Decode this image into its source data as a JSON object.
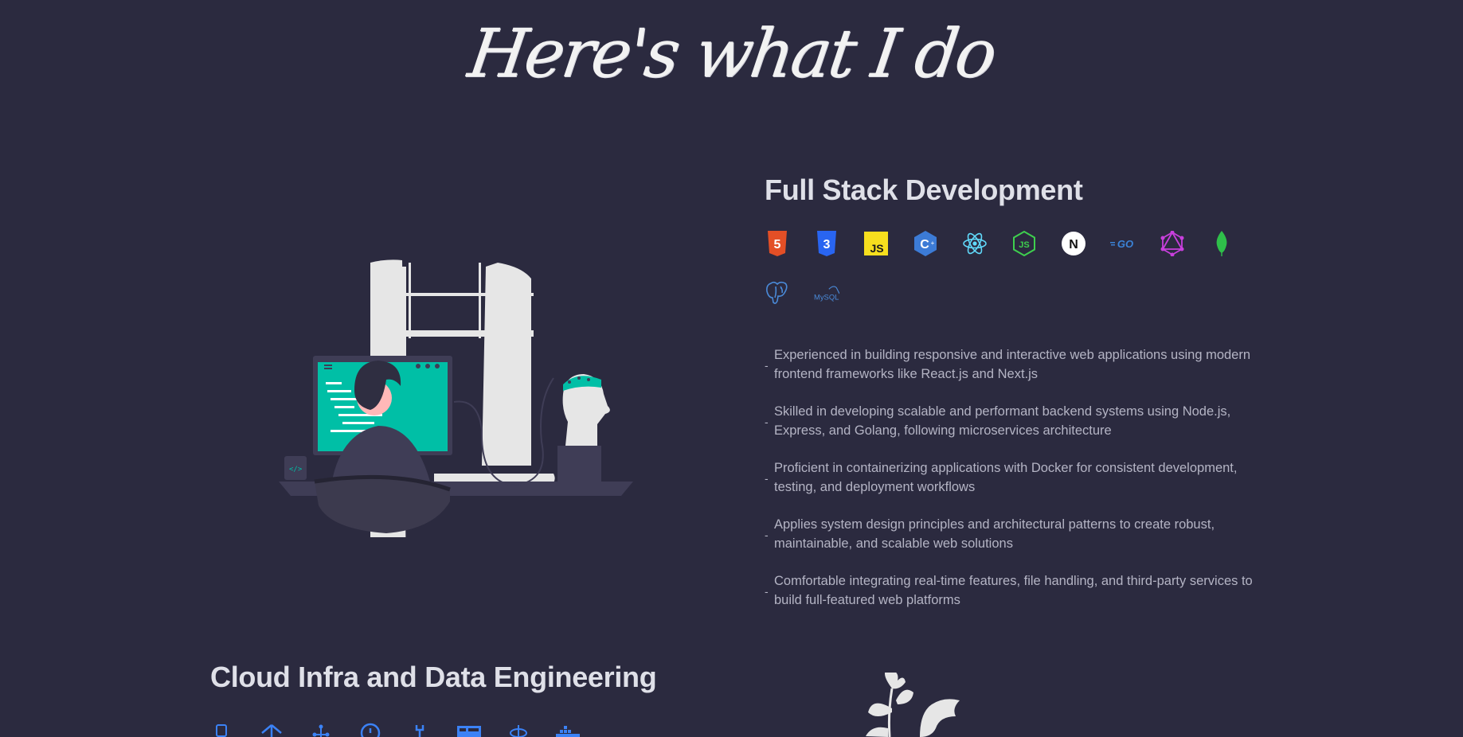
{
  "heading": "Here's what I do",
  "full_stack": {
    "title": "Full Stack Development",
    "icons": [
      {
        "name": "html5-icon",
        "color": "#e34f26",
        "glyph": "5"
      },
      {
        "name": "css3-icon",
        "color": "#2965f1",
        "glyph": "3"
      },
      {
        "name": "javascript-icon",
        "color": "#f7df1e",
        "glyph": "JS"
      },
      {
        "name": "cplusplus-icon",
        "color": "#3c7bd6",
        "glyph": "C"
      },
      {
        "name": "react-icon",
        "color": "#61dafb",
        "glyph": "⚛"
      },
      {
        "name": "nodejs-icon",
        "color": "#3ecf4e",
        "glyph": "JS"
      },
      {
        "name": "nextjs-icon",
        "color": "#ffffff",
        "glyph": "N"
      },
      {
        "name": "golang-icon",
        "color": "#3b82d6",
        "glyph": "GO"
      },
      {
        "name": "graphql-icon",
        "color": "#c83fdc",
        "glyph": "◈"
      },
      {
        "name": "mongodb-icon",
        "color": "#2fbf4a",
        "glyph": "❦"
      },
      {
        "name": "postgresql-icon",
        "color": "#4a8ad8",
        "glyph": "🐘"
      },
      {
        "name": "mysql-icon",
        "color": "#4a8ad8",
        "glyph": "MySQL"
      }
    ],
    "bullets": [
      "Experienced in building responsive and interactive web applications using modern frontend frameworks like React.js and Next.js",
      "Skilled in developing scalable and performant backend systems using Node.js, Express, and Golang, following microservices architecture",
      "Proficient in containerizing applications with Docker for consistent development, testing, and deployment workflows",
      "Applies system design principles and architectural patterns to create robust, maintainable, and scalable web solutions",
      "Comfortable integrating real-time features, file handling, and third-party services to build full-featured web platforms"
    ]
  },
  "cloud": {
    "title": "Cloud Infra and Data Engineering",
    "icons": [
      {
        "name": "server-icon",
        "color": "#3b82f6"
      },
      {
        "name": "network-icon",
        "color": "#3b82f6"
      },
      {
        "name": "hierarchy-icon",
        "color": "#3b82f6"
      },
      {
        "name": "clock-icon",
        "color": "#3b82f6"
      },
      {
        "name": "wrench-icon",
        "color": "#3b82f6"
      },
      {
        "name": "database-icon",
        "color": "#3b82f6"
      },
      {
        "name": "satellite-icon",
        "color": "#3b82f6"
      },
      {
        "name": "docker-icon",
        "color": "#3b82f6"
      }
    ]
  },
  "colors": {
    "background": "#2b2a3f",
    "accent": "#00bfa6",
    "text": "#dfe0e8",
    "muted": "#b4b4c4"
  }
}
